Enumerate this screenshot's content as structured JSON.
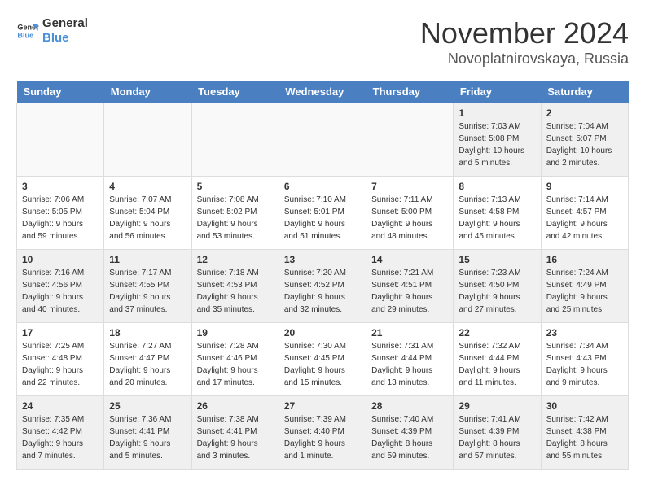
{
  "logo": {
    "line1": "General",
    "line2": "Blue"
  },
  "title": "November 2024",
  "location": "Novoplatnirovskaya, Russia",
  "days_of_week": [
    "Sunday",
    "Monday",
    "Tuesday",
    "Wednesday",
    "Thursday",
    "Friday",
    "Saturday"
  ],
  "weeks": [
    [
      {
        "day": "",
        "info": ""
      },
      {
        "day": "",
        "info": ""
      },
      {
        "day": "",
        "info": ""
      },
      {
        "day": "",
        "info": ""
      },
      {
        "day": "",
        "info": ""
      },
      {
        "day": "1",
        "info": "Sunrise: 7:03 AM\nSunset: 5:08 PM\nDaylight: 10 hours\nand 5 minutes."
      },
      {
        "day": "2",
        "info": "Sunrise: 7:04 AM\nSunset: 5:07 PM\nDaylight: 10 hours\nand 2 minutes."
      }
    ],
    [
      {
        "day": "3",
        "info": "Sunrise: 7:06 AM\nSunset: 5:05 PM\nDaylight: 9 hours\nand 59 minutes."
      },
      {
        "day": "4",
        "info": "Sunrise: 7:07 AM\nSunset: 5:04 PM\nDaylight: 9 hours\nand 56 minutes."
      },
      {
        "day": "5",
        "info": "Sunrise: 7:08 AM\nSunset: 5:02 PM\nDaylight: 9 hours\nand 53 minutes."
      },
      {
        "day": "6",
        "info": "Sunrise: 7:10 AM\nSunset: 5:01 PM\nDaylight: 9 hours\nand 51 minutes."
      },
      {
        "day": "7",
        "info": "Sunrise: 7:11 AM\nSunset: 5:00 PM\nDaylight: 9 hours\nand 48 minutes."
      },
      {
        "day": "8",
        "info": "Sunrise: 7:13 AM\nSunset: 4:58 PM\nDaylight: 9 hours\nand 45 minutes."
      },
      {
        "day": "9",
        "info": "Sunrise: 7:14 AM\nSunset: 4:57 PM\nDaylight: 9 hours\nand 42 minutes."
      }
    ],
    [
      {
        "day": "10",
        "info": "Sunrise: 7:16 AM\nSunset: 4:56 PM\nDaylight: 9 hours\nand 40 minutes."
      },
      {
        "day": "11",
        "info": "Sunrise: 7:17 AM\nSunset: 4:55 PM\nDaylight: 9 hours\nand 37 minutes."
      },
      {
        "day": "12",
        "info": "Sunrise: 7:18 AM\nSunset: 4:53 PM\nDaylight: 9 hours\nand 35 minutes."
      },
      {
        "day": "13",
        "info": "Sunrise: 7:20 AM\nSunset: 4:52 PM\nDaylight: 9 hours\nand 32 minutes."
      },
      {
        "day": "14",
        "info": "Sunrise: 7:21 AM\nSunset: 4:51 PM\nDaylight: 9 hours\nand 29 minutes."
      },
      {
        "day": "15",
        "info": "Sunrise: 7:23 AM\nSunset: 4:50 PM\nDaylight: 9 hours\nand 27 minutes."
      },
      {
        "day": "16",
        "info": "Sunrise: 7:24 AM\nSunset: 4:49 PM\nDaylight: 9 hours\nand 25 minutes."
      }
    ],
    [
      {
        "day": "17",
        "info": "Sunrise: 7:25 AM\nSunset: 4:48 PM\nDaylight: 9 hours\nand 22 minutes."
      },
      {
        "day": "18",
        "info": "Sunrise: 7:27 AM\nSunset: 4:47 PM\nDaylight: 9 hours\nand 20 minutes."
      },
      {
        "day": "19",
        "info": "Sunrise: 7:28 AM\nSunset: 4:46 PM\nDaylight: 9 hours\nand 17 minutes."
      },
      {
        "day": "20",
        "info": "Sunrise: 7:30 AM\nSunset: 4:45 PM\nDaylight: 9 hours\nand 15 minutes."
      },
      {
        "day": "21",
        "info": "Sunrise: 7:31 AM\nSunset: 4:44 PM\nDaylight: 9 hours\nand 13 minutes."
      },
      {
        "day": "22",
        "info": "Sunrise: 7:32 AM\nSunset: 4:44 PM\nDaylight: 9 hours\nand 11 minutes."
      },
      {
        "day": "23",
        "info": "Sunrise: 7:34 AM\nSunset: 4:43 PM\nDaylight: 9 hours\nand 9 minutes."
      }
    ],
    [
      {
        "day": "24",
        "info": "Sunrise: 7:35 AM\nSunset: 4:42 PM\nDaylight: 9 hours\nand 7 minutes."
      },
      {
        "day": "25",
        "info": "Sunrise: 7:36 AM\nSunset: 4:41 PM\nDaylight: 9 hours\nand 5 minutes."
      },
      {
        "day": "26",
        "info": "Sunrise: 7:38 AM\nSunset: 4:41 PM\nDaylight: 9 hours\nand 3 minutes."
      },
      {
        "day": "27",
        "info": "Sunrise: 7:39 AM\nSunset: 4:40 PM\nDaylight: 9 hours\nand 1 minute."
      },
      {
        "day": "28",
        "info": "Sunrise: 7:40 AM\nSunset: 4:39 PM\nDaylight: 8 hours\nand 59 minutes."
      },
      {
        "day": "29",
        "info": "Sunrise: 7:41 AM\nSunset: 4:39 PM\nDaylight: 8 hours\nand 57 minutes."
      },
      {
        "day": "30",
        "info": "Sunrise: 7:42 AM\nSunset: 4:38 PM\nDaylight: 8 hours\nand 55 minutes."
      }
    ]
  ]
}
